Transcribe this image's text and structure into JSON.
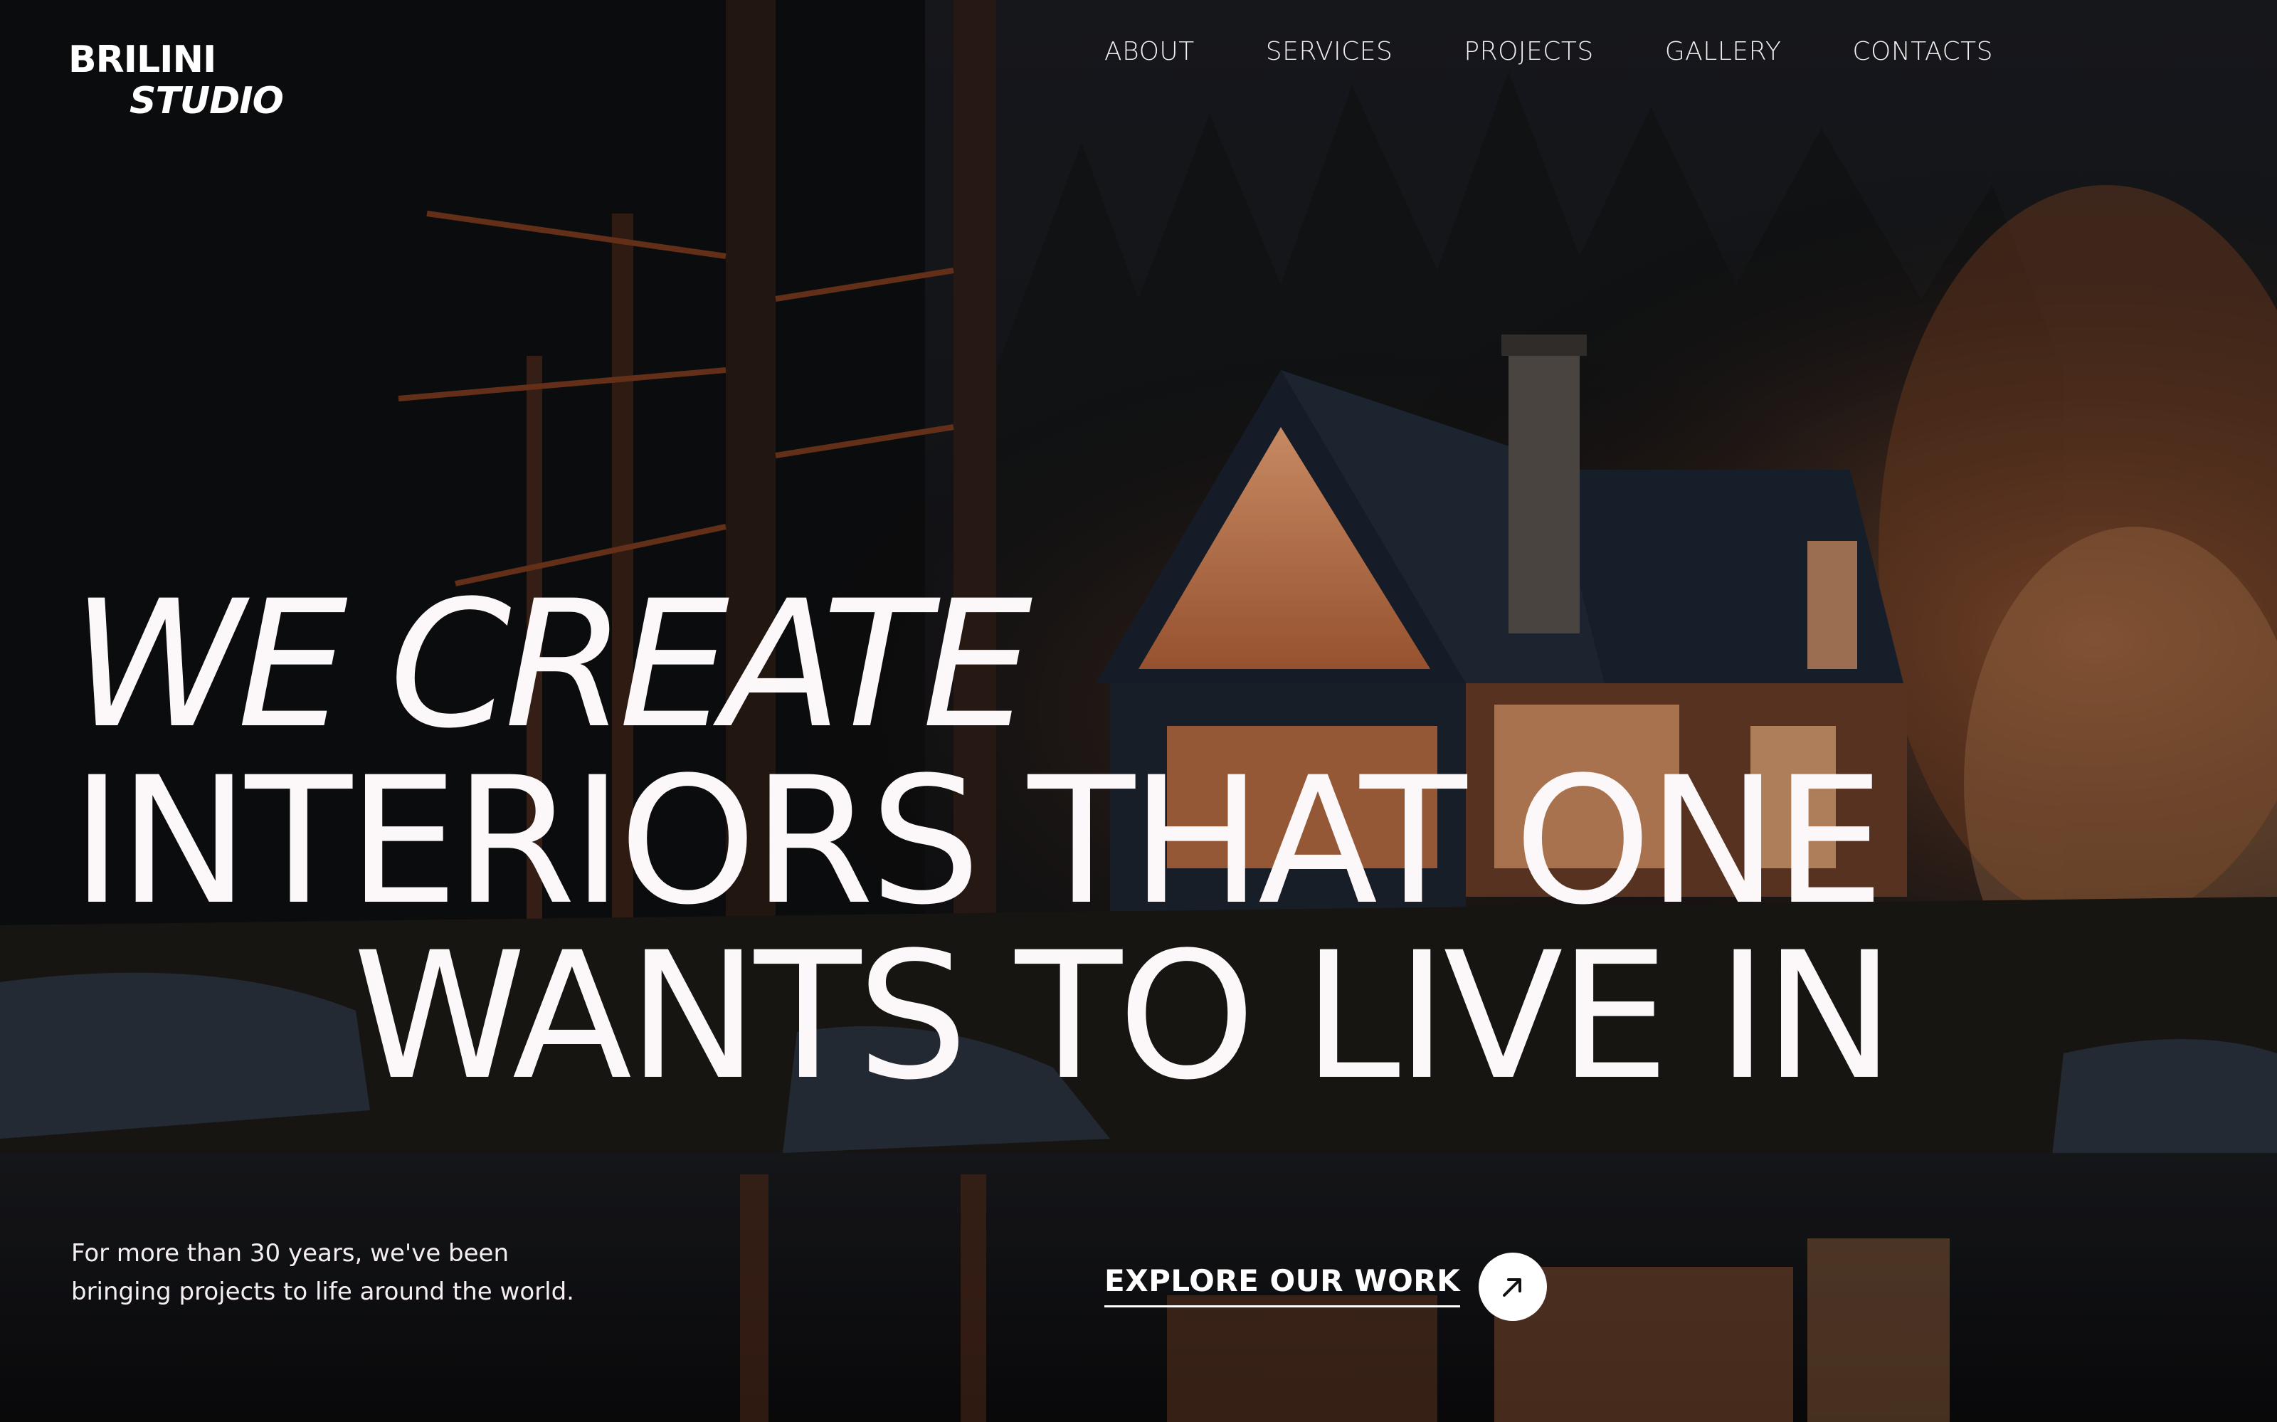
{
  "brand": {
    "line1": "BRILINI",
    "line2": "STUDIO"
  },
  "nav": {
    "items": [
      "ABOUT",
      "SERVICES",
      "PROJECTS",
      "GALLERY",
      "CONTACTS"
    ]
  },
  "hero": {
    "line1": "WE CREATE",
    "line2": "INTERIORS THAT ONE",
    "line3": "WANTS TO LIVE IN"
  },
  "tagline": {
    "line1": "For more than 30 years, we've been",
    "line2": "bringing projects to life around the world."
  },
  "cta": {
    "label": "EXPLORE OUR WORK",
    "icon": "arrow-up-right-icon"
  },
  "colors": {
    "text": "#ffffff",
    "background": "#0b0c10",
    "accent_warm": "#d9824a"
  }
}
